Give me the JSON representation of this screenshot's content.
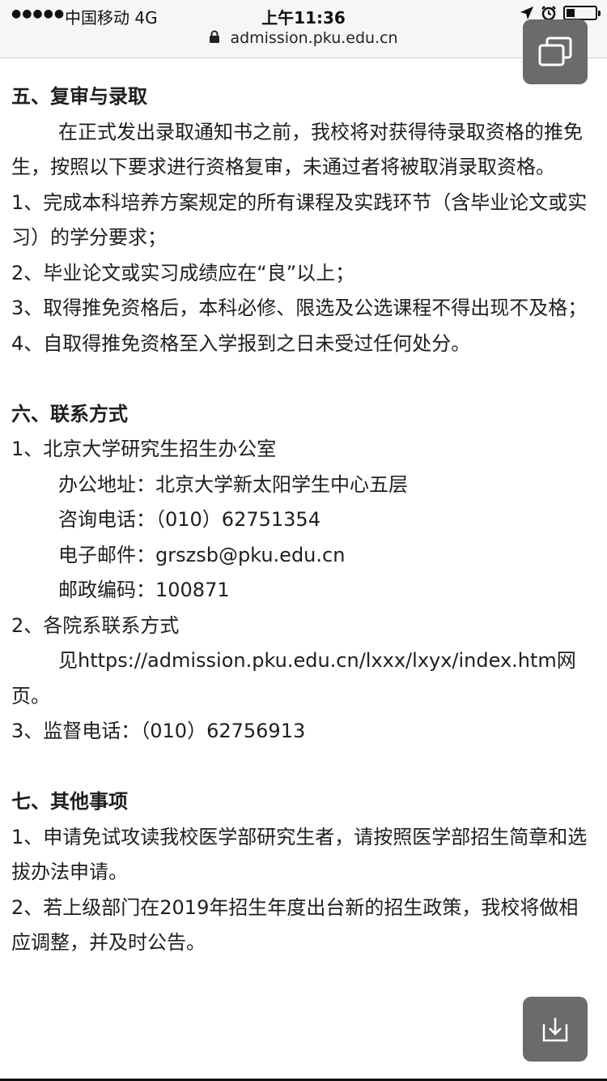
{
  "status_bar": {
    "signal": "●●●●●",
    "carrier": "中国移动   4G",
    "time": "上午11:36",
    "battery_level": 0.3
  },
  "url_bar": {
    "url": "admission.pku.edu.cn"
  },
  "sections": {
    "five": {
      "heading": "五、复审与录取",
      "intro": "在正式发出录取通知书之前，我校将对获得待录取资格的推免生，按照以下要求进行资格复审，未通过者将被取消录取资格。",
      "items": [
        "1、完成本科培养方案规定的所有课程及实践环节（含毕业论文或实习）的学分要求；",
        "2、毕业论文或实习成绩应在“良”以上；",
        "3、取得推免资格后，本科必修、限选及公选课程不得出现不及格；",
        "4、自取得推免资格至入学报到之日未受过任何处分。"
      ]
    },
    "six": {
      "heading": "六、联系方式",
      "item1": "1、北京大学研究生招生办公室",
      "address": "办公地址：北京大学新太阳学生中心五层",
      "phone": "咨询电话：（010）62751354",
      "email": "电子邮件：grszsb@pku.edu.cn",
      "postcode": "邮政编码：100871",
      "item2": "2、各院系联系方式",
      "item2_detail_prefix": "见",
      "item2_link": "https://admission.pku.edu.cn/lxxx/lxyx/index.htm",
      "item2_detail_suffix": "网页。",
      "item3": "3、监督电话：（010）62756913"
    },
    "seven": {
      "heading": "七、其他事项",
      "items": [
        "1、申请免试攻读我校医学部研究生者，请按照医学部招生简章和选拔办法申请。",
        "2、若上级部门在2019年招生年度出台新的招生政策，我校将做相应调整，并及时公告。"
      ]
    }
  },
  "icons": {
    "tabs_button": "tabs-icon",
    "save_button": "download-tray-icon",
    "location": "location-arrow-icon",
    "alarm": "alarm-clock-icon",
    "lock": "lock-icon"
  }
}
